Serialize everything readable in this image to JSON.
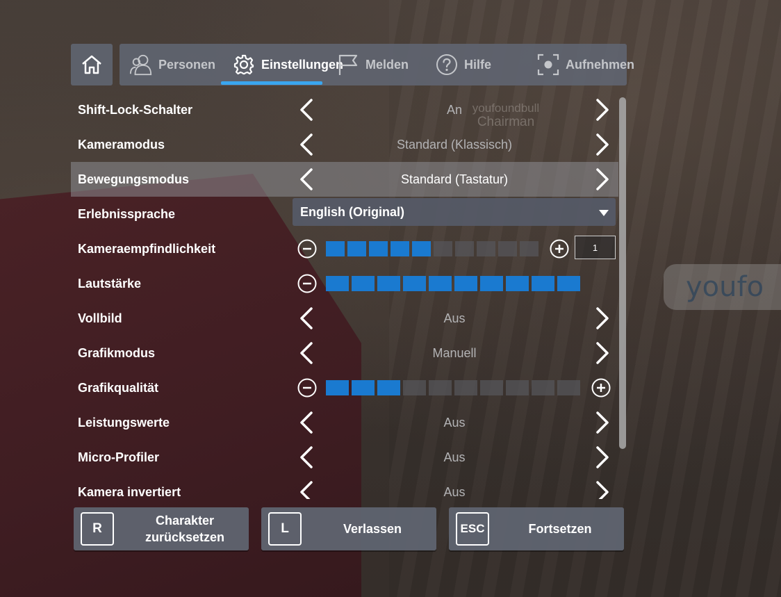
{
  "nav": {
    "tabs": [
      {
        "label": "Personen",
        "icon": "people-icon"
      },
      {
        "label": "Einstellungen",
        "icon": "gear-icon"
      },
      {
        "label": "Melden",
        "icon": "flag-icon"
      },
      {
        "label": "Hilfe",
        "icon": "help-icon"
      },
      {
        "label": "Aufnehmen",
        "icon": "record-icon"
      }
    ],
    "active_tab": "Einstellungen",
    "accent_color": "#3aa6ef"
  },
  "settings": [
    {
      "label": "Shift-Lock-Schalter",
      "type": "selector",
      "value": "An"
    },
    {
      "label": "Kameramodus",
      "type": "selector",
      "value": "Standard (Klassisch)"
    },
    {
      "label": "Bewegungsmodus",
      "type": "selector",
      "value": "Standard (Tastatur)",
      "highlighted": true
    },
    {
      "label": "Erlebnissprache",
      "type": "dropdown",
      "value": "English (Original)"
    },
    {
      "label": "Kameraempfindlichkeit",
      "type": "slider",
      "filled": 5,
      "total": 10,
      "input_value": "1"
    },
    {
      "label": "Lautstärke",
      "type": "slider",
      "filled": 10,
      "total": 10
    },
    {
      "label": "Vollbild",
      "type": "selector",
      "value": "Aus"
    },
    {
      "label": "Grafikmodus",
      "type": "selector",
      "value": "Manuell"
    },
    {
      "label": "Grafikqualität",
      "type": "slider",
      "filled": 3,
      "total": 10
    },
    {
      "label": "Leistungswerte",
      "type": "selector",
      "value": "Aus"
    },
    {
      "label": "Micro-Profiler",
      "type": "selector",
      "value": "Aus"
    },
    {
      "label": "Kamera invertiert",
      "type": "selector",
      "value": "Aus"
    }
  ],
  "bottom_buttons": [
    {
      "key": "R",
      "label": "Charakter zurücksetzen"
    },
    {
      "key": "L",
      "label": "Verlassen"
    },
    {
      "key": "ESC",
      "label": "Fortsetzen"
    }
  ],
  "scene": {
    "npc_name": "youfoundbull",
    "npc_rank": "Chairman",
    "chat_bubble": "youfo"
  },
  "colors": {
    "slider_on": "#1a7ad0",
    "panel_bg": "#5f6470"
  }
}
